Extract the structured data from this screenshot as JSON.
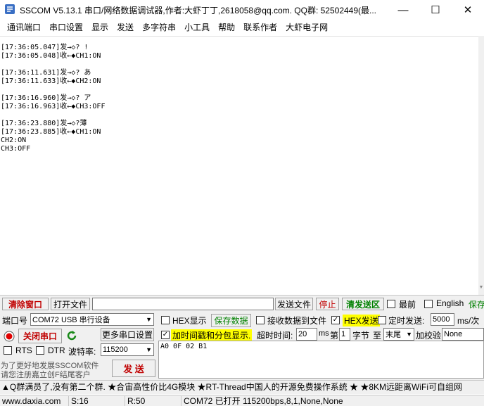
{
  "window": {
    "title": "SSCOM V5.13.1 串口/网络数据调试器,作者:大虾丁丁,2618058@qq.com. QQ群: 52502449(最...",
    "minimize_glyph": "—",
    "maximize_glyph": "☐",
    "close_glyph": "✕"
  },
  "menu": [
    "通讯端口",
    "串口设置",
    "显示",
    "发送",
    "多字符串",
    "小工具",
    "帮助",
    "联系作者",
    "大虾电子网"
  ],
  "output_log": "[17:36:05.047]发→◇? !\n[17:36:05.048]收←◆CH1:ON\n\n[17:36:11.631]发→◇? あ\n[17:36:11.633]收←◆CH2:ON\n\n[17:36:16.960]发→◇? ア\n[17:36:16.963]收←◆CH3:OFF\n\n[17:36:23.880]发→◇?薄\n[17:36:23.885]收←◆CH1:ON\nCH2:ON\nCH3:OFF",
  "row1": {
    "clear_button": "清除窗口",
    "open_file_button": "打开文件",
    "file_path": "",
    "send_file_button": "发送文件",
    "stop_button": "停止",
    "clear_send_button": "清发送区",
    "top_label": "最前",
    "english_label": "English",
    "save_params_button": "保存"
  },
  "row2": {
    "port_label": "端口号",
    "port_value": "COM72 USB 串行设备",
    "hex_display_label": "HEX显示",
    "save_data_button": "保存数据",
    "recv_to_file_label": "接收数据到文件",
    "hex_send_label": "HEX发送",
    "timed_send_label": "定时发送:",
    "interval_value": "5000",
    "interval_unit": "ms/次"
  },
  "row3": {
    "close_port_button": "关闭串口",
    "refresh_icon": "refresh-icon",
    "more_settings_button": "更多串口设置",
    "timestamp_label": "加时间戳和分包显示.",
    "timeout_label": "超时时间:",
    "timeout_value": "20",
    "timeout_unit": "ms",
    "nth_label": "第",
    "nth_value": "1",
    "byte_label": "字节",
    "to_label": "至",
    "end_value": "末尾",
    "checksum_label": "加校验",
    "checksum_value": "None"
  },
  "row4": {
    "rts_label": "RTS",
    "dtr_label": "DTR",
    "baud_label": "波特率:",
    "baud_value": "115200"
  },
  "promo": {
    "line1": "为了更好地发展SSCOM软件",
    "line2": "请您注册嘉立创F结尾客户"
  },
  "send_button": "发 送",
  "send_text": "A0 0F 02 B1",
  "marquee": "▲Q群满员了,没有第二个群. ★合宙高性价比4G模块 ★RT-Thread中国人的开源免费操作系统 ★ ★8KM远距离WiFi可自组网",
  "status": {
    "site": "www.daxia.com",
    "sent": "S:16",
    "received": "R:50",
    "port_state": "COM72 已打开  115200bps,8,1,None,None"
  },
  "colors": {
    "accent_red": "#c00000",
    "accent_green": "#008000",
    "highlight_yellow": "#ffff00",
    "panel_bg": "#f0f0f0"
  }
}
